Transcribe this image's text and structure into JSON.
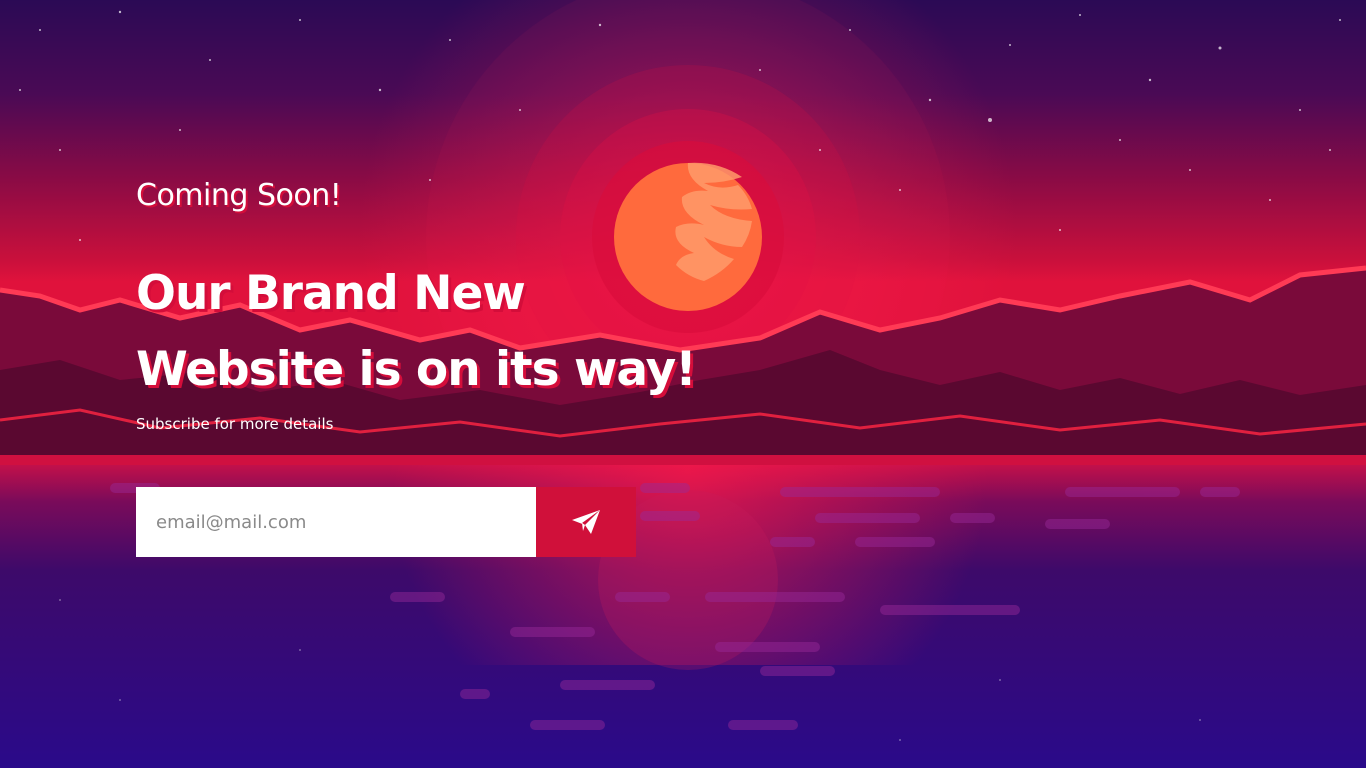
{
  "hero": {
    "eyebrow": "Coming Soon!",
    "headline_line1": "Our Brand New",
    "headline_line2": "Website is on its way!",
    "subtext": "Subscribe for more details"
  },
  "subscribe_form": {
    "email_placeholder": "email@mail.com",
    "submit_icon": "paper-plane-icon"
  },
  "colors": {
    "accent": "#d0103a",
    "sky_top": "#2b0a5a",
    "sky_horizon": "#b8123f",
    "moon": "#ff6a3d",
    "water": "#2a0a6e"
  }
}
